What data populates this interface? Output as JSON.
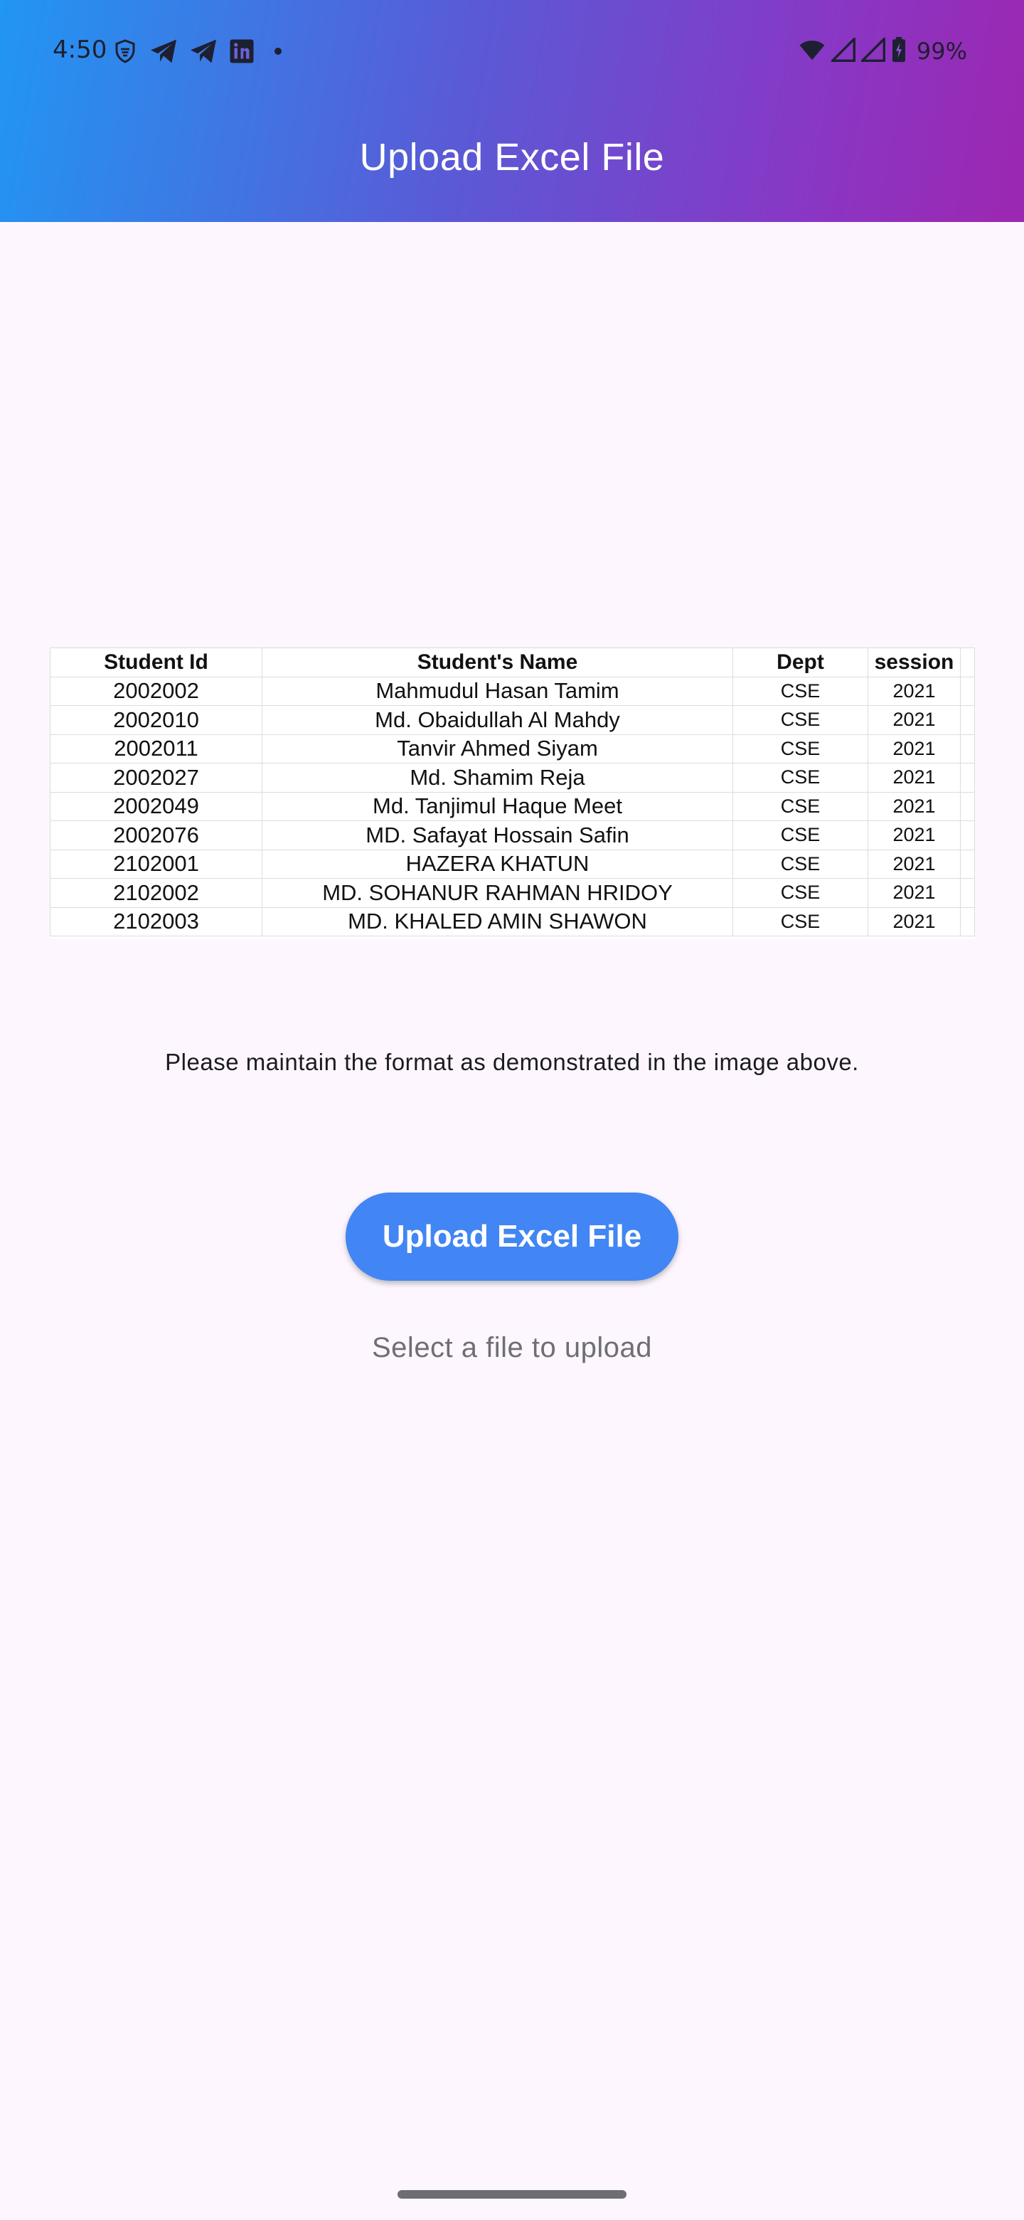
{
  "status_bar": {
    "time": "4:50",
    "battery": "99%",
    "left_icons": [
      "vpn-shield-icon",
      "telegram-icon",
      "telegram-icon",
      "linkedin-icon",
      "more-notifications-dot"
    ],
    "right_icons": [
      "wifi-icon",
      "signal-icon",
      "signal-icon",
      "battery-charging-icon"
    ]
  },
  "app_bar": {
    "title": "Upload Excel File",
    "gradient_start": "#2196f3",
    "gradient_end": "#9c27b0"
  },
  "sample_image": {
    "headers": [
      "Student Id",
      "Student's Name",
      "Dept",
      "session"
    ],
    "rows": [
      [
        "2002002",
        "Mahmudul Hasan Tamim",
        "CSE",
        "2021"
      ],
      [
        "2002010",
        "Md. Obaidullah Al Mahdy",
        "CSE",
        "2021"
      ],
      [
        "2002011",
        "Tanvir Ahmed Siyam",
        "CSE",
        "2021"
      ],
      [
        "2002027",
        "Md. Shamim Reja",
        "CSE",
        "2021"
      ],
      [
        "2002049",
        "Md. Tanjimul Haque Meet",
        "CSE",
        "2021"
      ],
      [
        "2002076",
        "MD. Safayat Hossain Safin",
        "CSE",
        "2021"
      ],
      [
        "2102001",
        "HAZERA KHATUN",
        "CSE",
        "2021"
      ],
      [
        "2102002",
        "MD. SOHANUR RAHMAN HRIDOY",
        "CSE",
        "2021"
      ],
      [
        "2102003",
        "MD. KHALED AMIN SHAWON",
        "CSE",
        "2021"
      ]
    ]
  },
  "main": {
    "instruction": "Please maintain the format as demonstrated in the image above.",
    "upload_button_label": "Upload Excel File",
    "upload_button_color": "#4285f4",
    "status_text": "Select a file to upload"
  }
}
